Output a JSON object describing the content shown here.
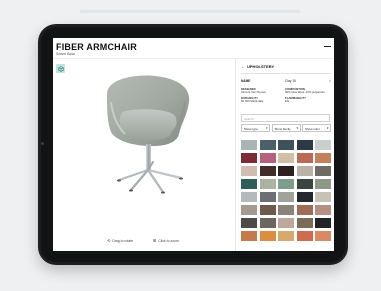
{
  "header": {
    "title": "FIBER ARMCHAIR",
    "subtitle": "Swivel Base"
  },
  "viewer": {
    "hint_rotate": "Drag to rotate",
    "hint_zoom": "Click to zoom"
  },
  "panel": {
    "back_label": "UPHOLSTERY",
    "name_label": "NAME",
    "name_value": "Clay 15",
    "specs": [
      {
        "label": "DESIGNER",
        "value": "Vincent Van Duysen"
      },
      {
        "label": "COMPOSITION",
        "value": "90% New Wool, 10% polyamide"
      },
      {
        "label": "DURABILITY",
        "value": "60,000 Martindale"
      },
      {
        "label": "FLAMMABILITY",
        "value": "EN"
      }
    ],
    "search_placeholder": "Search",
    "filters": [
      {
        "label": "Show type"
      },
      {
        "label": "Show family"
      },
      {
        "label": "Show color"
      }
    ]
  },
  "swatch_colors": [
    "#a9b4b7",
    "#4b6169",
    "#3f525c",
    "#2b3a45",
    "#c9cfcb",
    "#7a2b36",
    "#b5607c",
    "#d2c0a6",
    "#bb6a57",
    "#c3815c",
    "#cdbdb2",
    "#3f2e2a",
    "#2f1f1e",
    "#b8b2a8",
    "#6f6a62",
    "#2e5e57",
    "#aab3a1",
    "#7e9d8c",
    "#38463f",
    "#8d9888",
    "#b4b9bb",
    "#6c7073",
    "#a0a29c",
    "#23282d",
    "#c6c2b8",
    "#a49a8f",
    "#6e5b4b",
    "#8a8378",
    "#a16c55",
    "#b69082",
    "#4d4b48",
    "#6c6661",
    "#bea89c",
    "#7c6c56",
    "#222324",
    "#c67a4b",
    "#dc8d3f",
    "#d6a96d",
    "#cf6b4e",
    "#d98a62"
  ],
  "colors": {
    "accent_ar": "#bfe6dd",
    "device": "#1d1e20",
    "background": "#eef0f2"
  }
}
